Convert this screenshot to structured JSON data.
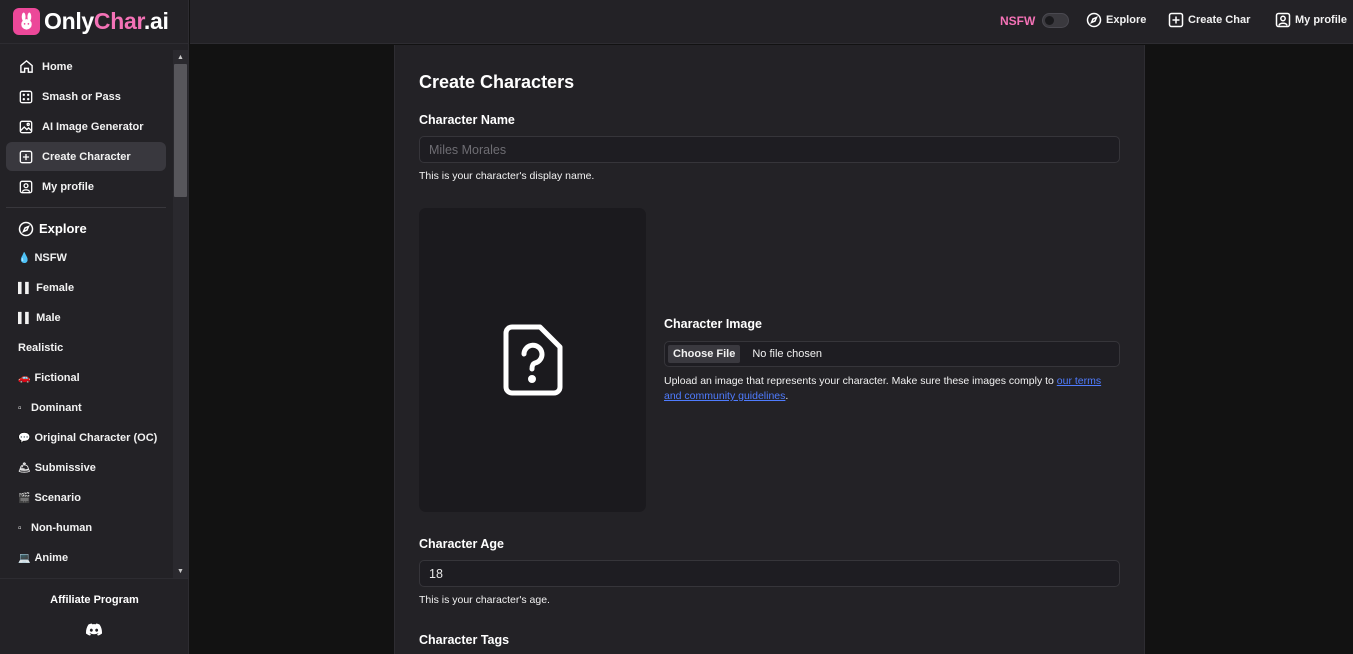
{
  "brand": {
    "name_part1": "Only",
    "name_part2": "Char",
    "name_part3": ".ai"
  },
  "sidebar": {
    "nav": [
      {
        "label": "Home",
        "icon": "home-icon"
      },
      {
        "label": "Smash or Pass",
        "icon": "grid-icon"
      },
      {
        "label": "AI Image Generator",
        "icon": "image-icon"
      },
      {
        "label": "Create Character",
        "icon": "plus-square-icon",
        "active": true
      },
      {
        "label": "My profile",
        "icon": "user-icon"
      }
    ],
    "explore_label": "Explore",
    "categories": [
      {
        "glyph": "💧",
        "label": "NSFW"
      },
      {
        "glyph": "▌▌",
        "label": "Female"
      },
      {
        "glyph": "▌▌",
        "label": "Male"
      },
      {
        "glyph": "",
        "label": "Realistic"
      },
      {
        "glyph": "🚗",
        "label": "Fictional"
      },
      {
        "glyph": "▫",
        "label": "Dominant"
      },
      {
        "glyph": "💬",
        "label": "Original Character (OC)"
      },
      {
        "glyph": "🛎",
        "label": "Submissive"
      },
      {
        "glyph": "🎬",
        "label": "Scenario"
      },
      {
        "glyph": "▫",
        "label": "Non-human"
      },
      {
        "glyph": "💻",
        "label": "Anime"
      }
    ],
    "affiliate": "Affiliate Program"
  },
  "topbar": {
    "nsfw_label": "NSFW",
    "nsfw_enabled": false,
    "explore": "Explore",
    "create_char": "Create Char",
    "my_profile": "My profile"
  },
  "form": {
    "title": "Create Characters",
    "name_label": "Character Name",
    "name_placeholder": "Miles Morales",
    "name_value": "",
    "name_help": "This is your character's display name.",
    "image_label": "Character Image",
    "choose_file": "Choose File",
    "file_status": "No file chosen",
    "image_help_prefix": "Upload an image that represents your character. Make sure these images comply to ",
    "image_help_link": "our terms and community guidelines",
    "image_help_suffix": ".",
    "age_label": "Character Age",
    "age_value": "18",
    "age_help": "This is your character's age.",
    "tags_label": "Character Tags"
  },
  "colors": {
    "accent": "#ec4899",
    "link": "#4f7cff",
    "panel": "#232226",
    "background": "#121212"
  }
}
